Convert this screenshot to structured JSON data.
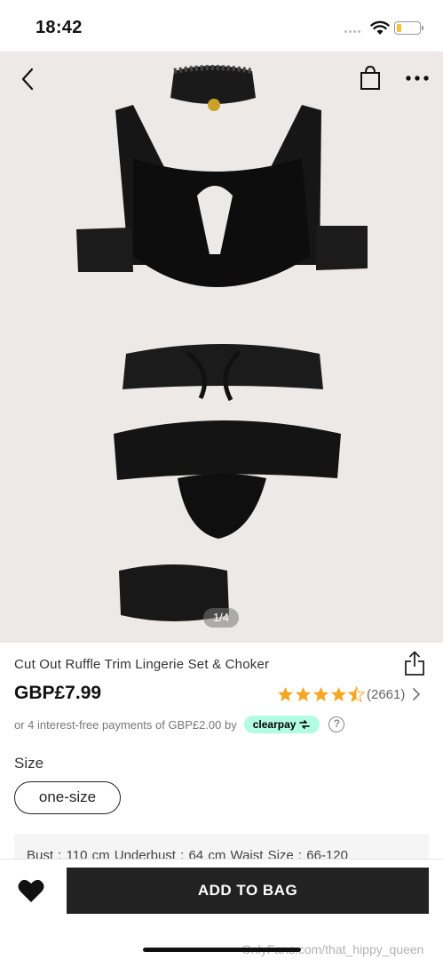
{
  "status_bar": {
    "time": "18:42"
  },
  "gallery": {
    "pager": "1/4",
    "nav": {
      "back": "back-chevron-icon",
      "bag": "shopping-bag-icon",
      "more": "more-dots-icon"
    }
  },
  "product": {
    "title": "Cut Out Ruffle Trim Lingerie Set & Choker",
    "price": "GBP£7.99",
    "rating": {
      "stars": 4.5,
      "count": "(2661)"
    },
    "payments": {
      "text": "or 4 interest-free payments of GBP£2.00 by",
      "provider": "clearpay",
      "provider_color": "#b2fce4"
    }
  },
  "size": {
    "label": "Size",
    "selected": "one-size"
  },
  "measurements": {
    "text": "Bust : 110 cm   Underbust : 64 cm   Waist Size : 66-120"
  },
  "bottom": {
    "add_to_bag": "ADD TO BAG"
  },
  "watermark": "OnlyFans.com/that_hippy_queen",
  "colors": {
    "accent_star": "#f5a623",
    "button_bg": "#222222"
  }
}
